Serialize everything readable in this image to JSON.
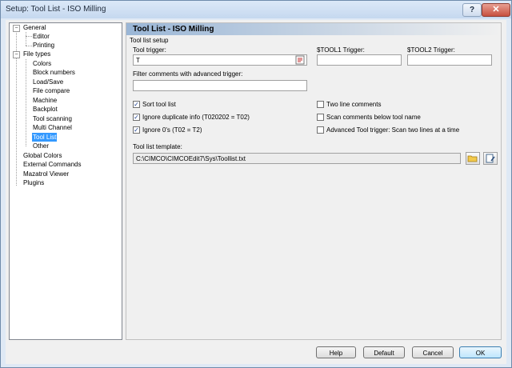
{
  "window": {
    "title": "Setup: Tool List - ISO Milling",
    "help_glyph": "?",
    "close_glyph": "✕"
  },
  "tree": {
    "items": [
      {
        "label": "General",
        "expander": "−"
      },
      {
        "label": "Editor"
      },
      {
        "label": "Printing"
      },
      {
        "label": "File types",
        "expander": "−"
      },
      {
        "label": "Colors"
      },
      {
        "label": "Block numbers"
      },
      {
        "label": "Load/Save"
      },
      {
        "label": "File compare"
      },
      {
        "label": "Machine"
      },
      {
        "label": "Backplot"
      },
      {
        "label": "Tool scanning"
      },
      {
        "label": "Multi Channel"
      },
      {
        "label": "Tool List",
        "selected": true
      },
      {
        "label": "Other"
      },
      {
        "label": "Global Colors"
      },
      {
        "label": "External Commands"
      },
      {
        "label": "Mazatrol Viewer"
      },
      {
        "label": "Plugins"
      }
    ]
  },
  "panel": {
    "title": "Tool List - ISO Milling",
    "group_label": "Tool list setup",
    "tool_trigger": {
      "label": "Tool trigger:",
      "value": "T"
    },
    "tool1_trigger": {
      "label": "$TOOL1 Trigger:",
      "value": ""
    },
    "tool2_trigger": {
      "label": "$TOOL2 Trigger:",
      "value": ""
    },
    "filter_comments": {
      "label": "Filter comments with advanced trigger:",
      "value": ""
    },
    "checkboxes": [
      {
        "label": "Sort tool list",
        "checked": true
      },
      {
        "label": "Ignore duplicate info (T020202 = T02)",
        "checked": true
      },
      {
        "label": "Ignore 0's (T02 = T2)",
        "checked": true
      },
      {
        "label": "Two line comments",
        "checked": false
      },
      {
        "label": "Scan comments below tool name",
        "checked": false
      },
      {
        "label": "Advanced Tool trigger: Scan two lines at a time",
        "checked": false
      }
    ],
    "template": {
      "label": "Tool list template:",
      "value": "C:\\CIMCO\\CIMCOEdit7\\Sys\\Toollist.txt"
    }
  },
  "buttons": {
    "help": "Help",
    "default": "Default",
    "cancel": "Cancel",
    "ok": "OK"
  },
  "colors": {
    "title_bg": "#c5d8ef",
    "selection": "#3399ff",
    "header_gradient_start": "#9ab6d6",
    "close_red": "#c75040"
  }
}
